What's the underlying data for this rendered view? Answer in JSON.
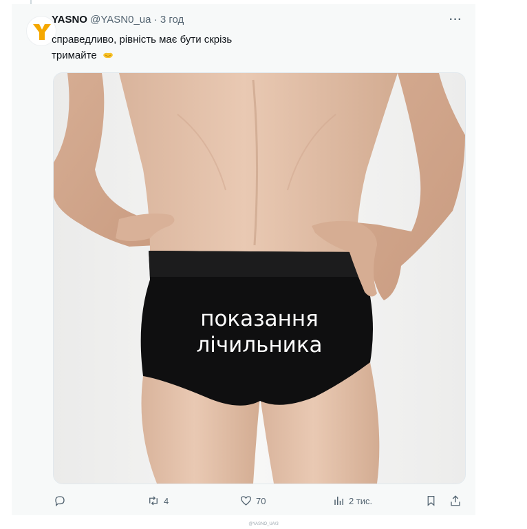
{
  "tweet": {
    "author_name": "YASNO",
    "handle": "@YASN0_ua",
    "separator": "·",
    "time": "3 год",
    "more_label": "···",
    "text_line1": "справедливо, рівність має бути скрізь",
    "text_line2": "тримайте",
    "emoji": "handshake-emoji",
    "media": {
      "caption_line1": "показання",
      "caption_line2": "лічильника"
    }
  },
  "actions": {
    "reply_count": "",
    "retweet_count": "4",
    "like_count": "70",
    "views_count": "2 тис.",
    "icons": [
      "reply-icon",
      "retweet-icon",
      "heart-icon",
      "views-icon",
      "bookmark-icon",
      "share-icon"
    ]
  },
  "watermark": "@YASNO_UA/3",
  "colors": {
    "brand_yellow": "#f5a800",
    "text_primary": "#0f1419",
    "text_secondary": "#536471",
    "card_background": "#f7f9f9"
  }
}
